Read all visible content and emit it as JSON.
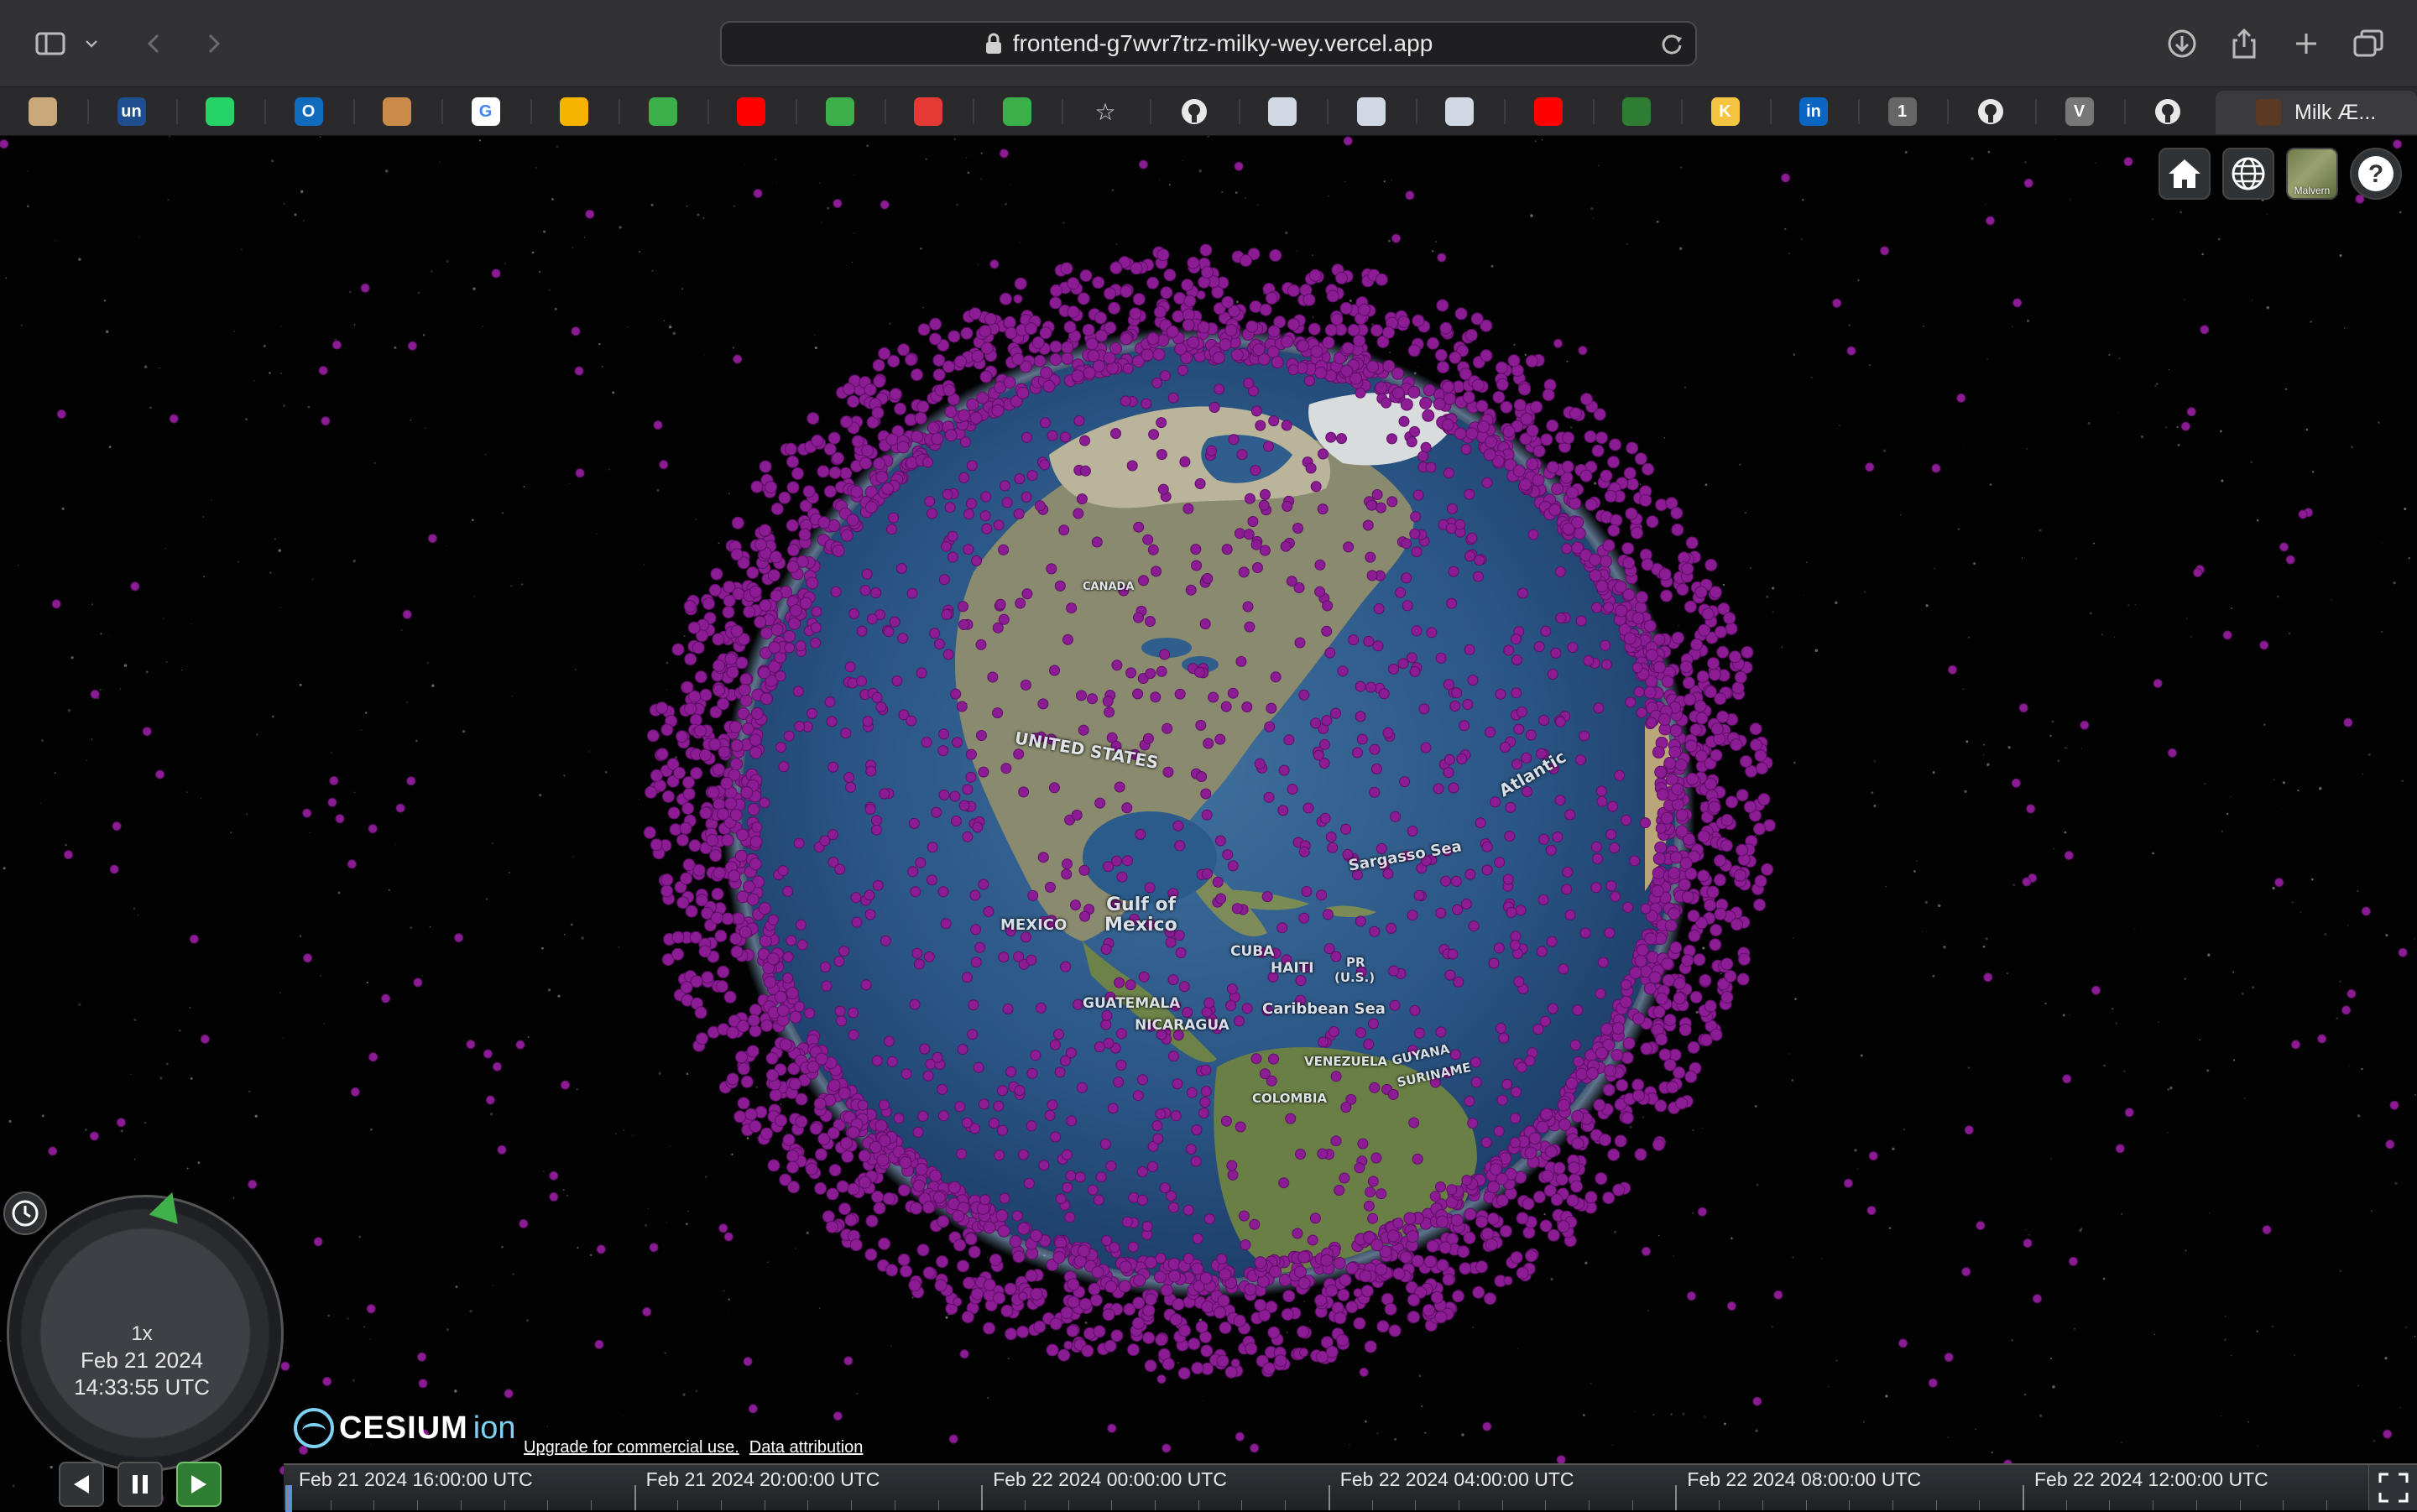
{
  "browser": {
    "url": "frontend-g7wvr7trz-milky-wey.vercel.app",
    "active_tab_title": "Milk Æ...",
    "bookmarks": [
      {
        "icon": "notion-boring-icon",
        "text": "",
        "color": "#c9a97a"
      },
      {
        "icon": "un-icon",
        "text": "un",
        "color": "#1f4f8f"
      },
      {
        "icon": "whatsapp-icon",
        "text": "",
        "color": "#25d366"
      },
      {
        "icon": "outlook-icon",
        "text": "O",
        "color": "#0f6cbd"
      },
      {
        "icon": "avatar-icon",
        "text": "",
        "color": "#c98b47"
      },
      {
        "icon": "google-icon",
        "text": "G",
        "color": "#ffffff"
      },
      {
        "icon": "google-drive-icon",
        "text": "",
        "color": "#f4b400"
      },
      {
        "icon": "green-app-icon",
        "text": "",
        "color": "#3bb04a"
      },
      {
        "icon": "youtube-icon",
        "text": "",
        "color": "#ff0000"
      },
      {
        "icon": "green-app-icon",
        "text": "",
        "color": "#3bb04a"
      },
      {
        "icon": "red-app-icon",
        "text": "",
        "color": "#e53935"
      },
      {
        "icon": "green-app-icon",
        "text": "",
        "color": "#3bb04a"
      },
      {
        "icon": "star-icon",
        "text": "☆",
        "color": "#2a2a2c"
      },
      {
        "icon": "github-icon",
        "text": "",
        "color": "#2a2a2c"
      },
      {
        "icon": "target-app-icon",
        "text": "",
        "color": "#cfd8e3"
      },
      {
        "icon": "target-app-icon",
        "text": "",
        "color": "#cfd8e3"
      },
      {
        "icon": "target-app-icon",
        "text": "",
        "color": "#cfd8e3"
      },
      {
        "icon": "youtube-icon",
        "text": "",
        "color": "#ff0000"
      },
      {
        "icon": "shield-app-icon",
        "text": "",
        "color": "#2e7d32"
      },
      {
        "icon": "k-icon",
        "text": "K",
        "color": "#f5c542"
      },
      {
        "icon": "linkedin-icon",
        "text": "in",
        "color": "#0a66c2"
      },
      {
        "icon": "one-icon",
        "text": "1",
        "color": "#666666"
      },
      {
        "icon": "github-icon",
        "text": "",
        "color": "#2a2a2c"
      },
      {
        "icon": "v-icon",
        "text": "V",
        "color": "#777777"
      },
      {
        "icon": "github-icon",
        "text": "",
        "color": "#2a2a2c"
      }
    ]
  },
  "viewer": {
    "satellite_color": "#8b1c93",
    "map_labels": [
      "UNITED STATES",
      "Gulf of",
      "Mexico",
      "MEXICO",
      "Atlantic",
      "Sargasso Sea",
      "CUBA",
      "HAITI",
      "PR",
      "(U.S.)",
      "GUATEMALA",
      "NICARAGUA",
      "Caribbean Sea",
      "VENEZUELA",
      "GUYANA",
      "SURINAME",
      "COLOMBIA",
      "CANADA"
    ],
    "toolbar": {
      "home": "home-icon",
      "scene_mode": "globe-icon",
      "base_layer_label": "Malvern",
      "help": "help-icon"
    }
  },
  "animation": {
    "speed": "1x",
    "date": "Feb 21 2024",
    "time": "14:33:55 UTC"
  },
  "credits": {
    "logo_main": "CESIUM",
    "logo_sub": "ion",
    "upgrade": "Upgrade for commercial use.",
    "attribution": "Data attribution"
  },
  "timeline": {
    "labels": [
      "Feb 21 2024 16:00:00 UTC",
      "Feb 21 2024 20:00:00 UTC",
      "Feb 22 2024 00:00:00 UTC",
      "Feb 22 2024 04:00:00 UTC",
      "Feb 22 2024 08:00:00 UTC",
      "Feb 22 2024 12:00:00 UTC"
    ]
  }
}
